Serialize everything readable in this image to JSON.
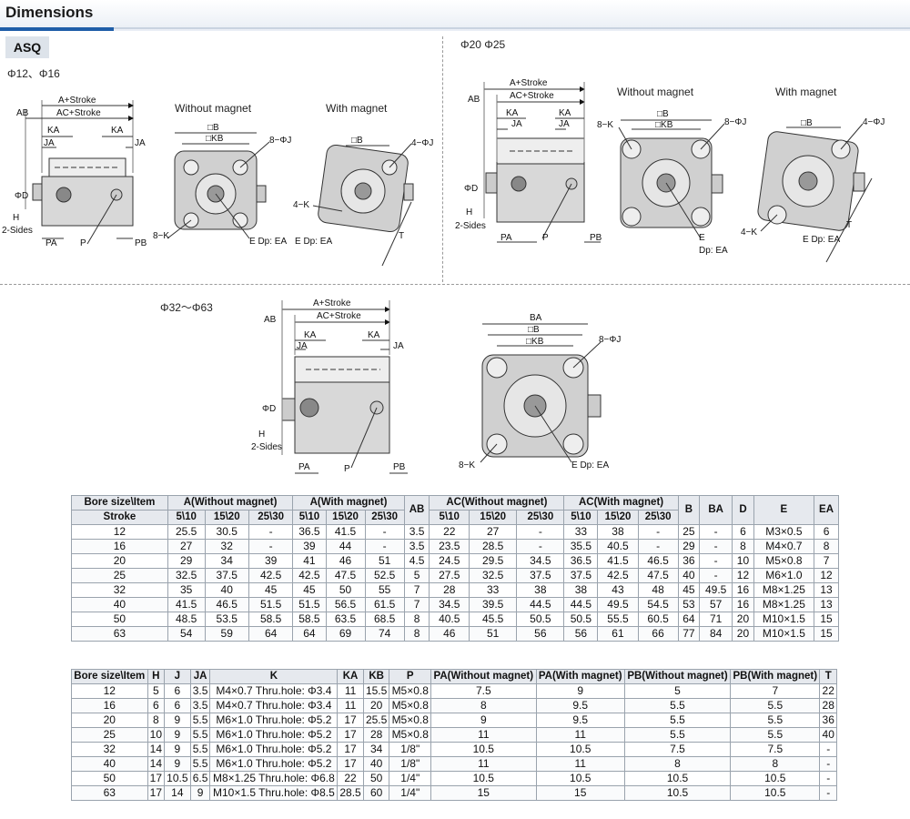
{
  "header": {
    "title": "Dimensions",
    "series": "ASQ"
  },
  "views": {
    "small_bore": {
      "title": "Φ12、Φ16",
      "without_magnet": "Without magnet",
      "with_magnet": "With magnet"
    },
    "mid_bore": {
      "title": "Φ20  Φ25",
      "without_magnet": "Without magnet",
      "with_magnet": "With magnet"
    },
    "large_bore": {
      "title": "Φ32～Φ63"
    }
  },
  "callouts": {
    "a_stroke": "A+Stroke",
    "ac_stroke": "AC+Stroke",
    "ab": "AB",
    "ka": "KA",
    "ja": "JA",
    "d": "ΦD",
    "h": "H",
    "two_sides": "2-Sides",
    "pa": "PA",
    "p": "P",
    "pb": "PB",
    "b": "□B",
    "kb": "□KB",
    "ba": "BA",
    "eight_j": "8−ΦJ",
    "four_j": "4−ΦJ",
    "eight_k": "8−K",
    "four_k": "4−K",
    "e_dp_ea": "E Dp: EA",
    "e": "E",
    "dp_ea": "Dp: EA",
    "t": "T"
  },
  "table1": {
    "header_row1": [
      "Bore size\\Item",
      "A(Without magnet)",
      "A(With magnet)",
      "AB",
      "AC(Without magnet)",
      "AC(With magnet)",
      "B",
      "BA",
      "D",
      "E",
      "EA"
    ],
    "header_row2": [
      "Stroke",
      "5\\10",
      "15\\20",
      "25\\30",
      "5\\10",
      "15\\20",
      "25\\30",
      "5\\10",
      "15\\20",
      "25\\30",
      "5\\10",
      "15\\20",
      "25\\30"
    ],
    "rows": [
      [
        "12",
        "25.5",
        "30.5",
        "-",
        "36.5",
        "41.5",
        "-",
        "3.5",
        "22",
        "27",
        "-",
        "33",
        "38",
        "-",
        "25",
        "-",
        "6",
        "M3×0.5",
        "6"
      ],
      [
        "16",
        "27",
        "32",
        "-",
        "39",
        "44",
        "-",
        "3.5",
        "23.5",
        "28.5",
        "-",
        "35.5",
        "40.5",
        "-",
        "29",
        "-",
        "8",
        "M4×0.7",
        "8"
      ],
      [
        "20",
        "29",
        "34",
        "39",
        "41",
        "46",
        "51",
        "4.5",
        "24.5",
        "29.5",
        "34.5",
        "36.5",
        "41.5",
        "46.5",
        "36",
        "-",
        "10",
        "M5×0.8",
        "7"
      ],
      [
        "25",
        "32.5",
        "37.5",
        "42.5",
        "42.5",
        "47.5",
        "52.5",
        "5",
        "27.5",
        "32.5",
        "37.5",
        "37.5",
        "42.5",
        "47.5",
        "40",
        "-",
        "12",
        "M6×1.0",
        "12"
      ],
      [
        "32",
        "35",
        "40",
        "45",
        "45",
        "50",
        "55",
        "7",
        "28",
        "33",
        "38",
        "38",
        "43",
        "48",
        "45",
        "49.5",
        "16",
        "M8×1.25",
        "13"
      ],
      [
        "40",
        "41.5",
        "46.5",
        "51.5",
        "51.5",
        "56.5",
        "61.5",
        "7",
        "34.5",
        "39.5",
        "44.5",
        "44.5",
        "49.5",
        "54.5",
        "53",
        "57",
        "16",
        "M8×1.25",
        "13"
      ],
      [
        "50",
        "48.5",
        "53.5",
        "58.5",
        "58.5",
        "63.5",
        "68.5",
        "8",
        "40.5",
        "45.5",
        "50.5",
        "50.5",
        "55.5",
        "60.5",
        "64",
        "71",
        "20",
        "M10×1.5",
        "15"
      ],
      [
        "63",
        "54",
        "59",
        "64",
        "64",
        "69",
        "74",
        "8",
        "46",
        "51",
        "56",
        "56",
        "61",
        "66",
        "77",
        "84",
        "20",
        "M10×1.5",
        "15"
      ]
    ]
  },
  "table2": {
    "header": [
      "Bore size\\Item",
      "H",
      "J",
      "JA",
      "K",
      "KA",
      "KB",
      "P",
      "PA(Without magnet)",
      "PA(With magnet)",
      "PB(Without magnet)",
      "PB(With magnet)",
      "T"
    ],
    "rows": [
      [
        "12",
        "5",
        "6",
        "3.5",
        "M4×0.7 Thru.hole: Φ3.4",
        "11",
        "15.5",
        "M5×0.8",
        "7.5",
        "9",
        "5",
        "7",
        "22"
      ],
      [
        "16",
        "6",
        "6",
        "3.5",
        "M4×0.7 Thru.hole: Φ3.4",
        "11",
        "20",
        "M5×0.8",
        "8",
        "9.5",
        "5.5",
        "5.5",
        "28"
      ],
      [
        "20",
        "8",
        "9",
        "5.5",
        "M6×1.0 Thru.hole: Φ5.2",
        "17",
        "25.5",
        "M5×0.8",
        "9",
        "9.5",
        "5.5",
        "5.5",
        "36"
      ],
      [
        "25",
        "10",
        "9",
        "5.5",
        "M6×1.0 Thru.hole: Φ5.2",
        "17",
        "28",
        "M5×0.8",
        "11",
        "11",
        "5.5",
        "5.5",
        "40"
      ],
      [
        "32",
        "14",
        "9",
        "5.5",
        "M6×1.0 Thru.hole: Φ5.2",
        "17",
        "34",
        "1/8\"",
        "10.5",
        "10.5",
        "7.5",
        "7.5",
        "-"
      ],
      [
        "40",
        "14",
        "9",
        "5.5",
        "M6×1.0 Thru.hole: Φ5.2",
        "17",
        "40",
        "1/8\"",
        "11",
        "11",
        "8",
        "8",
        "-"
      ],
      [
        "50",
        "17",
        "10.5",
        "6.5",
        "M8×1.25 Thru.hole: Φ6.8",
        "22",
        "50",
        "1/4\"",
        "10.5",
        "10.5",
        "10.5",
        "10.5",
        "-"
      ],
      [
        "63",
        "17",
        "14",
        "9",
        "M10×1.5 Thru.hole: Φ8.5",
        "28.5",
        "60",
        "1/4\"",
        "15",
        "15",
        "10.5",
        "10.5",
        "-"
      ]
    ]
  }
}
